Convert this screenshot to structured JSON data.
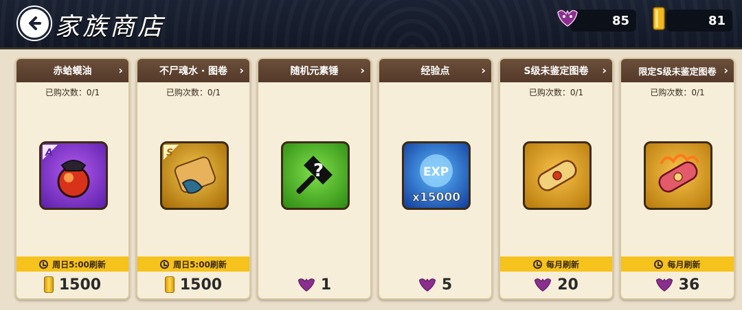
{
  "header": {
    "title": "家族商店",
    "currency_demon": "85",
    "currency_gold": "81"
  },
  "cards": [
    {
      "name": "赤蛤蟆油",
      "count": "已购次数：0/1",
      "refresh": "周日5:00刷新",
      "price": "1500",
      "currency": "gold",
      "icon": "fire-potion-icon",
      "rarity": "A"
    },
    {
      "name": "不尸魂水 · 图卷",
      "count": "已购次数：0/1",
      "refresh": "周日5:00刷新",
      "price": "1500",
      "currency": "gold",
      "icon": "scroll-icon",
      "rarity": "S"
    },
    {
      "name": "随机元素锤",
      "count": "",
      "refresh": "",
      "price": "1",
      "currency": "demon",
      "icon": "mystery-hammer-icon"
    },
    {
      "name": "经验点",
      "count": "",
      "refresh": "",
      "price": "5",
      "currency": "demon",
      "icon": "exp-orb-icon",
      "icon_label_exp": "EXP",
      "icon_label_qty": "x15000"
    },
    {
      "name": "S级未鉴定图卷",
      "count": "已购次数：0/1",
      "refresh": "每月刷新",
      "price": "20",
      "currency": "demon",
      "icon": "gold-scroll-icon"
    },
    {
      "name": "限定S级未鉴定图卷",
      "count": "已购次数：0/1",
      "refresh": "每月刷新",
      "price": "36",
      "currency": "demon",
      "icon": "red-scroll-icon"
    }
  ],
  "colors": {
    "card_header": "#5e4331",
    "refresh_bar": "#f6c21c",
    "topbar": "#171d2c"
  }
}
